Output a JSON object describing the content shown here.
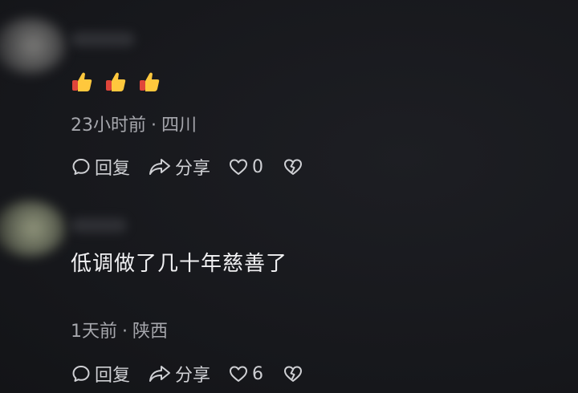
{
  "comments": [
    {
      "content_emojis": [
        "thumbs-up-emoji",
        "thumbs-up-emoji",
        "thumbs-up-emoji"
      ],
      "time": "23小时前",
      "separator": "·",
      "location": "四川",
      "reply_label": "回复",
      "share_label": "分享",
      "like_count": "0"
    },
    {
      "content": "低调做了几十年慈善了",
      "time": "1天前",
      "separator": "·",
      "location": "陕西",
      "reply_label": "回复",
      "share_label": "分享",
      "like_count": "6"
    }
  ],
  "colors": {
    "background": "#17181c",
    "primary_text": "#f1f1f3",
    "secondary_text": "#a6a7ad",
    "action_text": "#cfd0d4",
    "emoji_yellow": "#ffc83d",
    "emoji_cuff": "#e0453a"
  }
}
